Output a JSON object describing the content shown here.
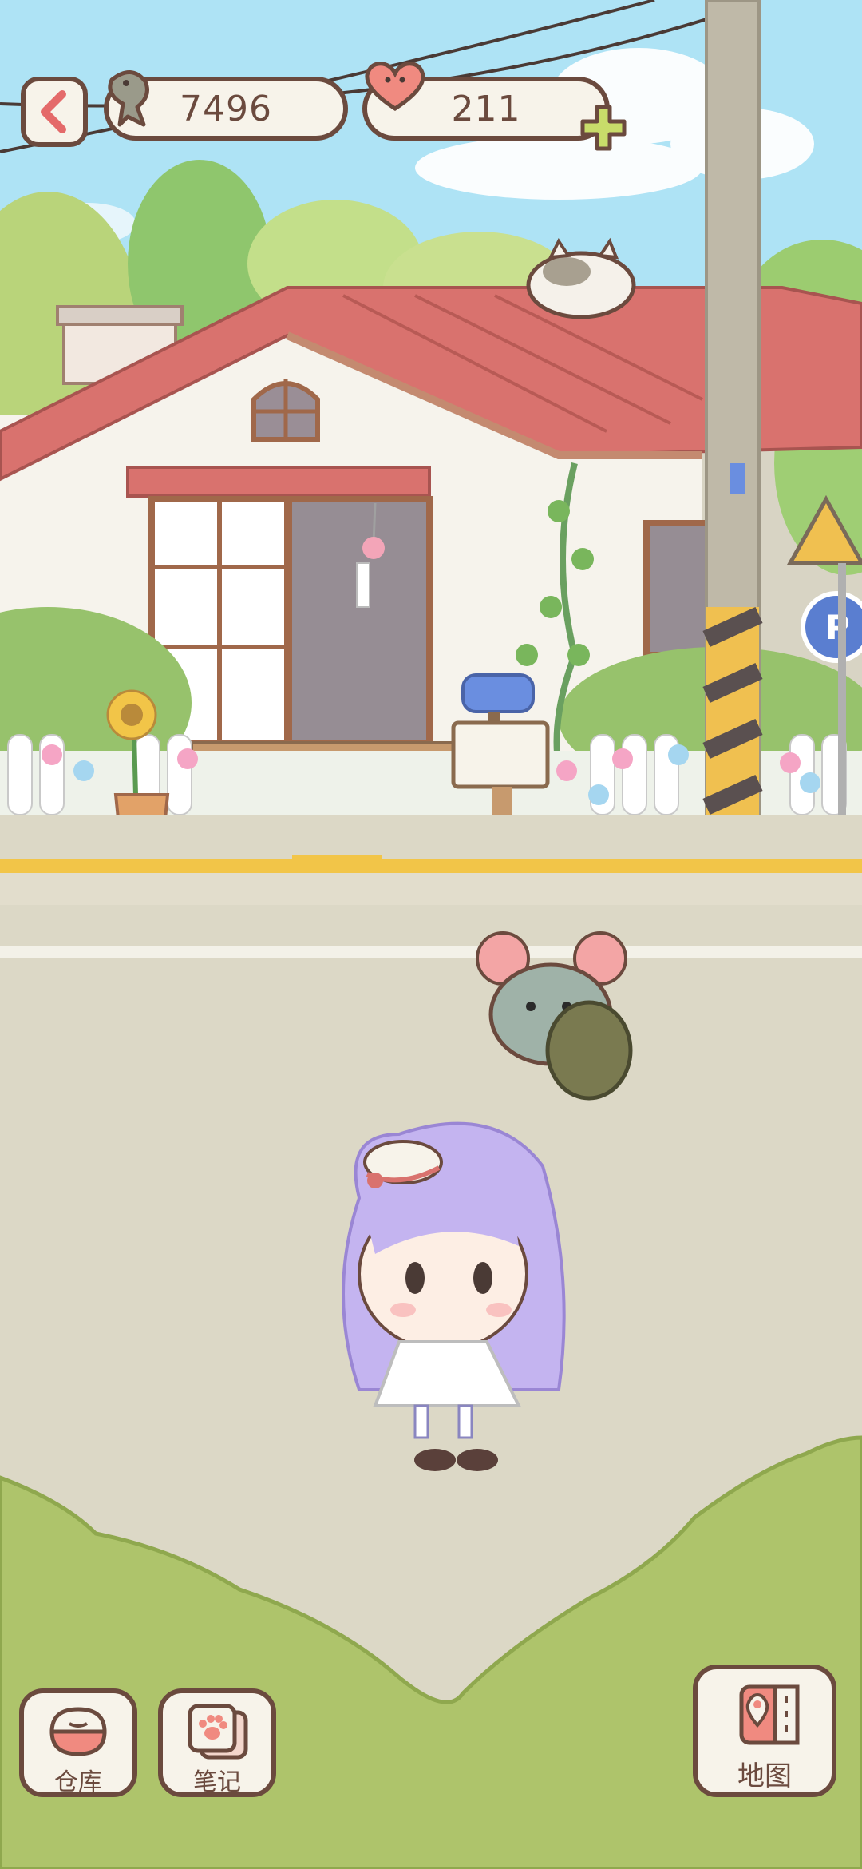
{
  "hud": {
    "back_icon": "chevron-left-icon",
    "fish_icon": "fish-icon",
    "fish_count": "7496",
    "heart_icon": "heart-icon",
    "heart_count": "211",
    "add_icon": "plus-icon"
  },
  "toolbar": {
    "warehouse_label": "仓库",
    "notes_label": "笔记",
    "map_label": "地图"
  },
  "colors": {
    "sky": "#aee3f5",
    "roof": "#d9726e",
    "grass": "#aec46b",
    "road": "#dcd8c6",
    "outline": "#6b4a3e",
    "plus": "#c8dc6a"
  }
}
